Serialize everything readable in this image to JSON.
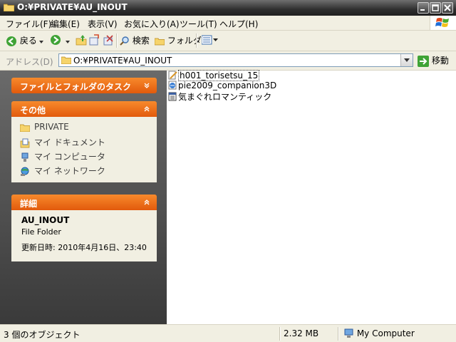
{
  "window": {
    "title": "O:¥PRIVATE¥AU_INOUT"
  },
  "menu": [
    {
      "label": "ファイル(F)"
    },
    {
      "label": "編集(E)"
    },
    {
      "label": "表示(V)"
    },
    {
      "label": "お気に入り(A)"
    },
    {
      "label": "ツール(T)"
    },
    {
      "label": "ヘルプ(H)"
    }
  ],
  "toolbar": {
    "back": "戻る",
    "search": "検索",
    "folders": "フォルダ"
  },
  "address": {
    "label": "アドレス(D)",
    "value": "O:¥PRIVATE¥AU_INOUT",
    "go": "移動"
  },
  "tasks": {
    "file_folder_tasks": "ファイルとフォルダのタスク",
    "other_places": {
      "title": "その他",
      "items": [
        {
          "label": "PRIVATE",
          "icon": "folder-icon"
        },
        {
          "label": "マイ ドキュメント",
          "icon": "my-documents-icon"
        },
        {
          "label": "マイ コンピュータ",
          "icon": "my-computer-icon"
        },
        {
          "label": "マイ ネットワーク",
          "icon": "my-network-icon"
        }
      ]
    },
    "details": {
      "title": "詳細",
      "name": "AU_INOUT",
      "type": "File Folder",
      "modified": "更新日時: 2010年4月16日、23:40"
    }
  },
  "files": [
    {
      "name": "h001_torisetsu_15",
      "icon": "document-pencil-icon",
      "selected": true
    },
    {
      "name": "pie2009_companion3D",
      "icon": "web-page-icon",
      "selected": false
    },
    {
      "name": "気まぐれロマンティック",
      "icon": "text-document-icon",
      "selected": false
    }
  ],
  "status": {
    "objects": "3 個のオブジェクト",
    "size": "2.32 MB",
    "location": "My Computer"
  },
  "colors": {
    "accent": "#e8650f",
    "title_bar": "#2f2f2f",
    "pane_bg": "#4a4a4a"
  }
}
